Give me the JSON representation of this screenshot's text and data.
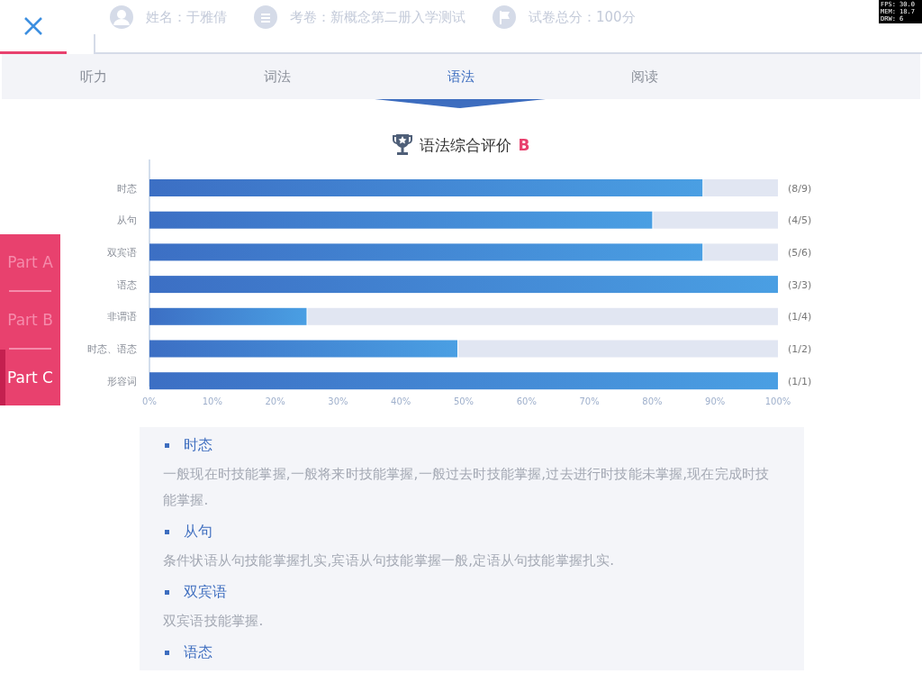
{
  "header": {
    "student": "姓名：于雅倩",
    "paper": "考卷：新概念第二册入学测试",
    "total": "试卷总分：100分"
  },
  "debug": [
    "FPS: 30.0",
    "MEM: 18.7",
    "DRW: 6"
  ],
  "tabs": [
    {
      "label": "听力",
      "selected": false
    },
    {
      "label": "词法",
      "selected": false
    },
    {
      "label": "语法",
      "selected": true
    },
    {
      "label": "阅读",
      "selected": false
    }
  ],
  "parts": [
    {
      "label": "Part A",
      "selected": false
    },
    {
      "label": "Part B",
      "selected": false
    },
    {
      "label": "Part C",
      "selected": true
    }
  ],
  "summary": {
    "title": "语法综合评价",
    "grade": "B"
  },
  "chart_data": {
    "type": "bar",
    "orientation": "horizontal",
    "categories": [
      "时态",
      "从句",
      "双宾语",
      "语态",
      "非谓语",
      "时态、语态",
      "形容词"
    ],
    "stacked": true,
    "series": [
      {
        "color": "#4a9fe3",
        "values": [
          88,
          80,
          88,
          100,
          25,
          49,
          100
        ]
      },
      {
        "color": "#e1e6f2",
        "values": [
          12,
          20,
          12,
          0,
          75,
          51,
          0
        ]
      }
    ],
    "xlim": [
      0,
      100
    ],
    "xticks": [
      {
        "value": 0,
        "label": "0%"
      },
      {
        "value": 10,
        "label": "10%"
      },
      {
        "value": 20,
        "label": "20%"
      },
      {
        "value": 30,
        "label": "30%"
      },
      {
        "value": 40,
        "label": "40%"
      },
      {
        "value": 50,
        "label": "50%"
      },
      {
        "value": 60,
        "label": "60%"
      },
      {
        "value": 70,
        "label": "70%"
      },
      {
        "value": 80,
        "label": "80%"
      },
      {
        "value": 90,
        "label": "90%"
      },
      {
        "value": 100,
        "label": "100%"
      }
    ],
    "value_labels": [
      "(8/9)",
      "(4/5)",
      "(5/6)",
      "(3/3)",
      "(1/4)",
      "(1/2)",
      "(1/1)"
    ]
  },
  "sections": [
    {
      "title": "时态",
      "text": "一般现在时技能掌握,一般将来时技能掌握,一般过去时技能掌握,过去进行时技能未掌握,现在完成时技能掌握."
    },
    {
      "title": "从句",
      "text": "条件状语从句技能掌握扎实,宾语从句技能掌握一般,定语从句技能掌握扎实."
    },
    {
      "title": "双宾语",
      "text": "双宾语技能掌握."
    },
    {
      "title": "语态"
    }
  ]
}
